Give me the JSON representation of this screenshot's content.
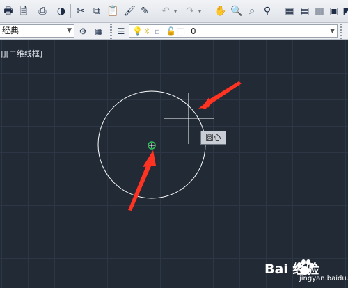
{
  "toolbar2": {
    "workspace_value": "经典",
    "layer_value": "0"
  },
  "viewport": {
    "label": "]][二维线框]"
  },
  "tooltip": {
    "label": "圆心"
  },
  "watermark": {
    "brand": "Bai 经验",
    "sub": "jingyan.baidu.com"
  },
  "colors": {
    "canvas_bg": "#222a35",
    "annotation_arrow": "#ff3322",
    "snap_marker": "#2ec05a",
    "circle_stroke": "#ffffff"
  },
  "icons": [
    "print-icon",
    "print-preview-icon",
    "publish-icon",
    "3d-dwf-icon",
    "cut-icon",
    "copy-icon",
    "paste-icon",
    "match-properties-icon",
    "undo-icon",
    "redo-icon",
    "pan-icon",
    "zoom-realtime-icon",
    "zoom-window-icon",
    "zoom-previous-icon",
    "properties-icon",
    "design-center-icon",
    "tool-palettes-icon",
    "sheet-set-icon",
    "markup-icon",
    "quickcalc-icon"
  ]
}
